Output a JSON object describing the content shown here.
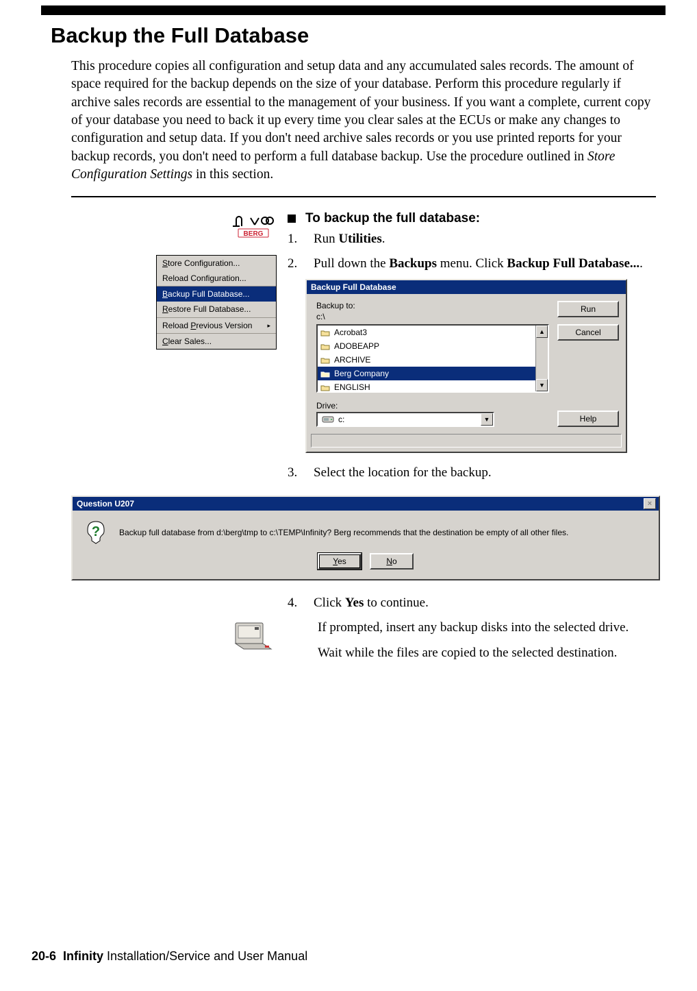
{
  "title": "Backup the Full Database",
  "intro": {
    "before_em": "This procedure copies all configuration and setup data and any accumulated sales records. The amount of space required for the backup depends on the size of your database. Perform this procedure regularly if archive sales records are essential to the management of your business. If you want a complete, current copy of your database you need to back it up every time you clear sales at the ECUs or make any changes to configuration and setup data. If you don't need archive sales records or you use printed reports for your backup records, you don't need to perform a full database backup. Use the procedure outlined in ",
    "em": "Store Configuration Settings",
    "after_em": " in this section."
  },
  "proc_heading": "To backup the full database:",
  "steps": {
    "s1": {
      "num": "1.",
      "before": "Run ",
      "bold": "Utilities",
      "after": "."
    },
    "s2": {
      "num": "2.",
      "before": "Pull down the ",
      "bold1": "Backups",
      "mid": " menu. Click ",
      "bold2": "Backup Full Database...",
      "after": "."
    },
    "s3": {
      "num": "3.",
      "text": "Select the location for the backup."
    },
    "s4": {
      "num": "4.",
      "before": "Click ",
      "bold": "Yes",
      "after": " to continue.",
      "p2": "If prompted, insert any backup disks into the selected drive.",
      "p3": "Wait while the files are copied to the selected destination."
    }
  },
  "menu": {
    "items": [
      {
        "u": "S",
        "rest": "tore Configuration..."
      },
      {
        "u": "",
        "rest": "Reload Configuration..."
      }
    ],
    "selected": {
      "u": "B",
      "rest": "ackup Full Database..."
    },
    "items2": [
      {
        "u": "R",
        "rest": "estore Full Database..."
      }
    ],
    "items3": [
      {
        "u": "",
        "pre": "Reload ",
        "u2": "P",
        "rest": "revious Version",
        "arrow": "▸"
      }
    ],
    "items4": [
      {
        "u": "C",
        "rest": "lear Sales..."
      }
    ]
  },
  "dialog": {
    "title": "Backup Full Database",
    "backup_to_label": "Backup to:",
    "path": "c:\\",
    "folders": [
      "Acrobat3",
      "ADOBEAPP",
      "ARCHIVE",
      "Berg Company",
      "ENGLISH"
    ],
    "selected_index": 3,
    "drive_label": "Drive:",
    "drive_value": "c:",
    "buttons": {
      "run": "Run",
      "cancel": "Cancel",
      "help": "Help"
    },
    "scroll_up": "▲",
    "scroll_down": "▼",
    "combo_arrow": "▼"
  },
  "question": {
    "title": "Question U207",
    "text": "Backup full database from d:\\berg\\tmp to c:\\TEMP\\Infinity? Berg recommends that the destination be empty of all other files.",
    "yes": "Yes",
    "no": "No",
    "yes_u": "Y",
    "no_u": "N",
    "close": "×"
  },
  "footer": {
    "page": "20-6",
    "product": "Infinity",
    "rest": " Installation/Service and User Manual"
  }
}
